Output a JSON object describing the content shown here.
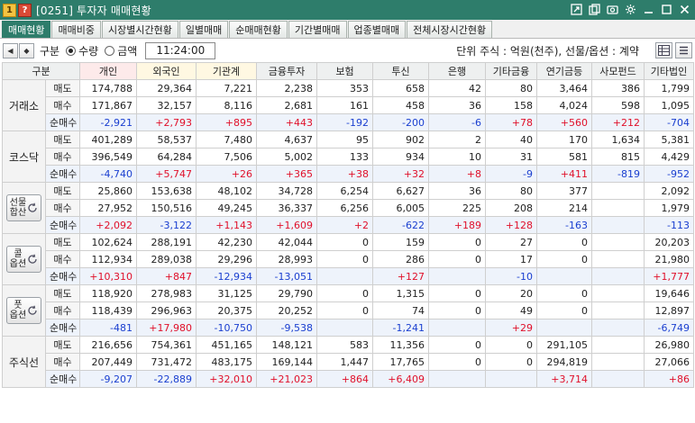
{
  "window": {
    "badge1": "1",
    "badge2": "?",
    "title": "[0251] 투자자 매매현황",
    "accent": "#2e7d6b"
  },
  "tabs": [
    {
      "label": "매매현황",
      "active": true
    },
    {
      "label": "매매비중",
      "active": false
    },
    {
      "label": "시장별시간현황",
      "active": false
    },
    {
      "label": "일별매매",
      "active": false
    },
    {
      "label": "순매매현황",
      "active": false
    },
    {
      "label": "기간별매매",
      "active": false
    },
    {
      "label": "업종별매매",
      "active": false
    },
    {
      "label": "전체시장시간현황",
      "active": false
    }
  ],
  "toolbar": {
    "division_label": "구분",
    "radio_qty": "수량",
    "radio_amount": "금액",
    "selected": "수량",
    "time": "11:24:00",
    "unit_text": "단위 주식 : 억원(천주), 선물/옵션 : 계약"
  },
  "table": {
    "headers": [
      "구분",
      "개인",
      "외국인",
      "기관계",
      "금융투자",
      "보험",
      "투신",
      "은행",
      "기타금융",
      "연기금등",
      "사모펀드",
      "기타법인"
    ],
    "row_labels": {
      "sell": "매도",
      "buy": "매수",
      "net": "순매수"
    },
    "groups": [
      {
        "name": "거래소",
        "button": false,
        "sell": [
          "174,788",
          "29,364",
          "7,221",
          "2,238",
          "353",
          "658",
          "42",
          "80",
          "3,464",
          "386",
          "1,799"
        ],
        "buy": [
          "171,867",
          "32,157",
          "8,116",
          "2,681",
          "161",
          "458",
          "36",
          "158",
          "4,024",
          "598",
          "1,095"
        ],
        "net": [
          "-2,921",
          "+2,793",
          "+895",
          "+443",
          "-192",
          "-200",
          "-6",
          "+78",
          "+560",
          "+212",
          "-704"
        ]
      },
      {
        "name": "코스닥",
        "button": false,
        "sell": [
          "401,289",
          "58,537",
          "7,480",
          "4,637",
          "95",
          "902",
          "2",
          "40",
          "170",
          "1,634",
          "5,381"
        ],
        "buy": [
          "396,549",
          "64,284",
          "7,506",
          "5,002",
          "133",
          "934",
          "10",
          "31",
          "581",
          "815",
          "4,429"
        ],
        "net": [
          "-4,740",
          "+5,747",
          "+26",
          "+365",
          "+38",
          "+32",
          "+8",
          "-9",
          "+411",
          "-819",
          "-952"
        ]
      },
      {
        "name": "선물합산",
        "button": true,
        "label_lines": [
          "선물",
          "합산"
        ],
        "sell": [
          "25,860",
          "153,638",
          "48,102",
          "34,728",
          "6,254",
          "6,627",
          "36",
          "80",
          "377",
          "",
          "2,092"
        ],
        "buy": [
          "27,952",
          "150,516",
          "49,245",
          "36,337",
          "6,256",
          "6,005",
          "225",
          "208",
          "214",
          "",
          "1,979"
        ],
        "net": [
          "+2,092",
          "-3,122",
          "+1,143",
          "+1,609",
          "+2",
          "-622",
          "+189",
          "+128",
          "-163",
          "",
          "-113"
        ]
      },
      {
        "name": "콜옵션",
        "button": true,
        "label_lines": [
          "콜",
          "옵션"
        ],
        "sell": [
          "102,624",
          "288,191",
          "42,230",
          "42,044",
          "0",
          "159",
          "0",
          "27",
          "0",
          "",
          "20,203"
        ],
        "buy": [
          "112,934",
          "289,038",
          "29,296",
          "28,993",
          "0",
          "286",
          "0",
          "17",
          "0",
          "",
          "21,980"
        ],
        "net": [
          "+10,310",
          "+847",
          "-12,934",
          "-13,051",
          "",
          "+127",
          "",
          "-10",
          "",
          "",
          "+1,777"
        ]
      },
      {
        "name": "풋옵션",
        "button": true,
        "label_lines": [
          "풋",
          "옵션"
        ],
        "sell": [
          "118,920",
          "278,983",
          "31,125",
          "29,790",
          "0",
          "1,315",
          "0",
          "20",
          "0",
          "",
          "19,646"
        ],
        "buy": [
          "118,439",
          "296,963",
          "20,375",
          "20,252",
          "0",
          "74",
          "0",
          "49",
          "0",
          "",
          "12,897"
        ],
        "net": [
          "-481",
          "+17,980",
          "-10,750",
          "-9,538",
          "",
          "-1,241",
          "",
          "+29",
          "",
          "",
          "-6,749"
        ]
      },
      {
        "name": "주식선",
        "button": false,
        "sell": [
          "216,656",
          "754,361",
          "451,165",
          "148,121",
          "583",
          "11,356",
          "0",
          "0",
          "291,105",
          "",
          "26,980"
        ],
        "buy": [
          "207,449",
          "731,472",
          "483,175",
          "169,144",
          "1,447",
          "17,765",
          "0",
          "0",
          "294,819",
          "",
          "27,066"
        ],
        "net": [
          "-9,207",
          "-22,889",
          "+32,010",
          "+21,023",
          "+864",
          "+6,409",
          "",
          "",
          "+3,714",
          "",
          "+86"
        ]
      }
    ]
  },
  "colors": {
    "positive": "#e0102a",
    "negative": "#1a3fd0"
  }
}
